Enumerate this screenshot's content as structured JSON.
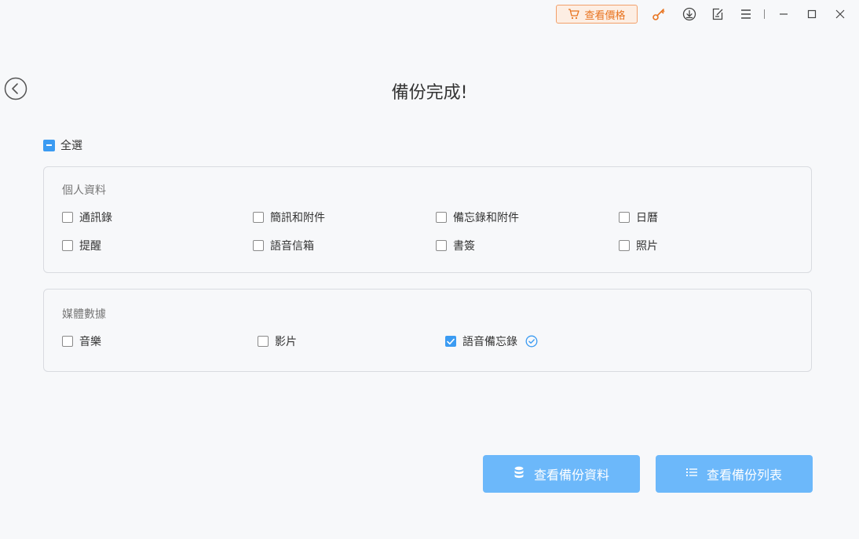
{
  "titlebar": {
    "price_label": "查看價格",
    "icons": [
      "cart-icon",
      "key-icon",
      "download-icon",
      "feedback-icon",
      "menu-icon",
      "minimize-icon",
      "maximize-icon",
      "close-icon"
    ]
  },
  "page": {
    "title": "備份完成!",
    "select_all_label": "全選",
    "select_all_state": "indeterminate"
  },
  "sections": [
    {
      "title": "個人資料",
      "items": [
        {
          "label": "通訊錄",
          "checked": false
        },
        {
          "label": "簡訊和附件",
          "checked": false
        },
        {
          "label": "備忘錄和附件",
          "checked": false
        },
        {
          "label": "日曆",
          "checked": false
        },
        {
          "label": "提醒",
          "checked": false
        },
        {
          "label": "語音信箱",
          "checked": false
        },
        {
          "label": "書簽",
          "checked": false
        },
        {
          "label": "照片",
          "checked": false
        }
      ]
    },
    {
      "title": "媒體數據",
      "items": [
        {
          "label": "音樂",
          "checked": false
        },
        {
          "label": "影片",
          "checked": false
        },
        {
          "label": "語音備忘錄",
          "checked": true,
          "status": "done-check-icon"
        }
      ]
    }
  ],
  "actions": {
    "view_backup_data_label": "查看備份資料",
    "view_backup_list_label": "查看備份列表"
  },
  "colors": {
    "accent": "#3b9bf2",
    "button": "#6cb8fa",
    "price_border": "#f2a06a",
    "price_text": "#e8731f",
    "key_icon": "#e8731f"
  }
}
